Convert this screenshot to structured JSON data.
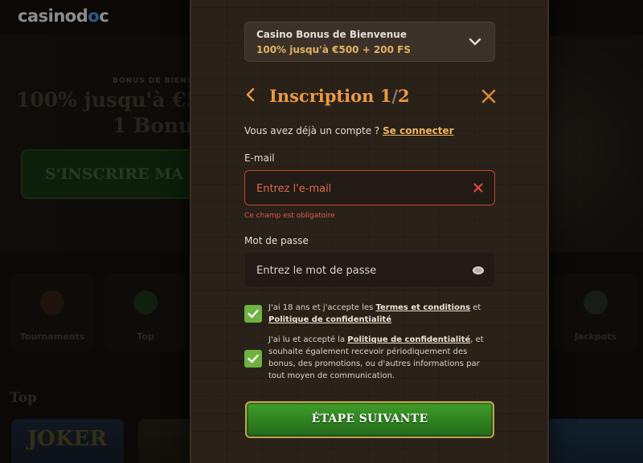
{
  "background": {
    "logo": {
      "part1": "casino",
      "part2": "d",
      "part3": "o",
      "part4": "c"
    },
    "hero": {
      "eyebrow": "BONUS DE BIENV",
      "line1": "100% jusqu'à €50",
      "line2": "1 Bonus",
      "cta_label": "S'INSCRIRE MA"
    },
    "categories": [
      {
        "label": "Tournaments"
      },
      {
        "label": "Top"
      },
      {
        "label": "Jackpots"
      }
    ],
    "section_title": "Top",
    "thumbnail_text": "JOKER"
  },
  "modal": {
    "bonus": {
      "title": "Casino Bonus de Bienvenue",
      "subtitle": "100% jusqu'à €500 + 200 FS"
    },
    "title_main": "Inscription 1",
    "title_sep": "/",
    "title_total": "2",
    "login_prompt": "Vous avez déjà un compte ?",
    "login_link": "Se connecter",
    "email": {
      "label": "E-mail",
      "placeholder": "Entrez l'e-mail",
      "error": "Ce champ est obligatoire"
    },
    "password": {
      "label": "Mot de passe",
      "placeholder": "Entrez le mot de passe"
    },
    "checkbox_terms": {
      "text_before": "J'ai 18 ans et j'accepte les ",
      "link1": "Termes et conditions",
      "text_mid": " et ",
      "link2": "Politique de confidentialité",
      "checked": true
    },
    "checkbox_marketing": {
      "text_before": "J'ai lu et accepté la ",
      "link": "Politique de confidentialité",
      "text_after": ", et souhaite également recevoir périodiquement des bonus, des promotions, ou d'autres informations par tout moyen de communication.",
      "checked": true
    },
    "next_button_label": "ÉTAPE SUIVANTE"
  },
  "colors": {
    "accent_orange": "#e99a44",
    "error_red": "#e25d43",
    "checkbox_green": "#6db33f",
    "button_green": "#2f8220",
    "button_border_gold": "#c4a24a"
  }
}
